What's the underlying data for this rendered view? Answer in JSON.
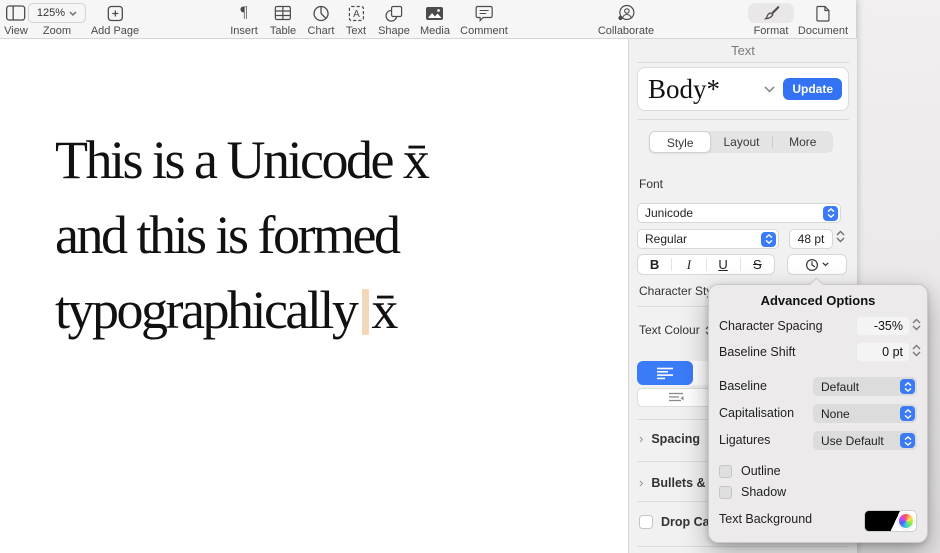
{
  "toolbar": {
    "items": [
      {
        "label": "View"
      },
      {
        "label": "Zoom",
        "value": "125%"
      },
      {
        "label": "Add Page"
      },
      {
        "label": "Insert"
      },
      {
        "label": "Table"
      },
      {
        "label": "Chart"
      },
      {
        "label": "Text"
      },
      {
        "label": "Shape"
      },
      {
        "label": "Media"
      },
      {
        "label": "Comment"
      },
      {
        "label": "Collaborate"
      },
      {
        "label": "Format"
      },
      {
        "label": "Document"
      }
    ]
  },
  "document": {
    "line1": "This is a Unicode x̄",
    "line2": "and this is formed",
    "line3_pre": "typographically",
    "line3_selected": "x̄"
  },
  "sidebar": {
    "panel_title": "Text",
    "paragraph_style": {
      "name": "Body*",
      "update_label": "Update"
    },
    "tabs": [
      {
        "label": "Style",
        "selected": true
      },
      {
        "label": "Layout",
        "selected": false
      },
      {
        "label": "More",
        "selected": false
      }
    ],
    "font": {
      "section_label": "Font",
      "family": "Junicode",
      "style": "Regular",
      "size": "48 pt",
      "bold": "B",
      "italic": "I",
      "underline": "U",
      "strikethrough": "S"
    },
    "character_styles_label": "Character Styles",
    "text_colour_label": "Text Colour",
    "spacing_label": "Spacing",
    "bullets_label": "Bullets & Lists",
    "drop_cap_label": "Drop Cap"
  },
  "popover": {
    "title": "Advanced Options",
    "character_spacing": {
      "label": "Character Spacing",
      "value": "-35%"
    },
    "baseline_shift": {
      "label": "Baseline Shift",
      "value": "0 pt"
    },
    "baseline": {
      "label": "Baseline",
      "value": "Default"
    },
    "capitalisation": {
      "label": "Capitalisation",
      "value": "None"
    },
    "ligatures": {
      "label": "Ligatures",
      "value": "Use Default"
    },
    "outline": {
      "label": "Outline",
      "checked": false
    },
    "shadow": {
      "label": "Shadow",
      "checked": false
    },
    "text_background_label": "Text Background"
  },
  "colors": {
    "accent_blue": "#3b7bf8",
    "update_button": "#3472f4",
    "selection_highlight": "#f2d7ba"
  }
}
